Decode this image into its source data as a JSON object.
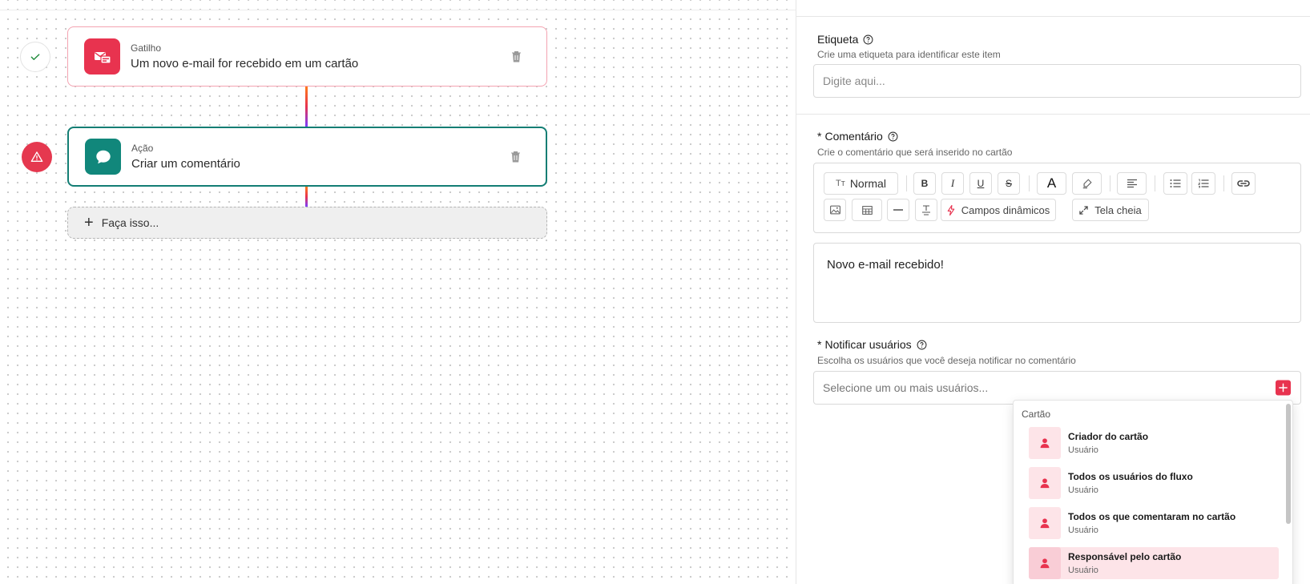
{
  "canvas": {
    "trigger": {
      "kind": "Gatilho",
      "title": "Um novo e-mail for recebido em um cartão"
    },
    "action": {
      "kind": "Ação",
      "title": "Criar um comentário"
    },
    "add_step": {
      "plus": "+",
      "label": "Faça isso..."
    }
  },
  "panel": {
    "etiqueta": {
      "label": "Etiqueta",
      "description": "Crie uma etiqueta para identificar este item",
      "placeholder": "Digite aqui..."
    },
    "comentario": {
      "required": "*",
      "label": "Comentário",
      "description": "Crie o comentário que será inserido no cartão",
      "toolbar": {
        "format": "Normal",
        "format_icon": "Tт",
        "bold": "B",
        "italic": "I",
        "underline": "U",
        "strike": "S",
        "font_color": "A",
        "dynamic_fields": "Campos dinâmicos",
        "fullscreen": "Tela cheia"
      },
      "value": "Novo e-mail recebido!"
    },
    "notificar": {
      "required": "*",
      "label": "Notificar usuários",
      "description": "Escolha os usuários que você deseja notificar no comentário",
      "placeholder": "Selecione um ou mais usuários..."
    },
    "dropdown": {
      "group": "Cartão",
      "items": [
        {
          "name": "Criador do cartão",
          "type": "Usuário"
        },
        {
          "name": "Todos os usuários do fluxo",
          "type": "Usuário"
        },
        {
          "name": "Todos os que comentaram no cartão",
          "type": "Usuário"
        },
        {
          "name": "Responsável pelo cartão",
          "type": "Usuário"
        }
      ]
    }
  },
  "colors": {
    "brand_red": "#e8334f",
    "action_teal": "#11877b",
    "highlight_pink": "#fde4e8"
  }
}
